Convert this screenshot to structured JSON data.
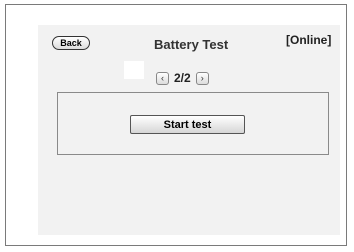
{
  "header": {
    "back_label": "Back",
    "title": "Battery Test",
    "status": "[Online]"
  },
  "pager": {
    "text": "2/2",
    "prev_icon": "chevron-left-icon",
    "next_icon": "chevron-right-icon"
  },
  "panel": {
    "start_label": "Start test"
  }
}
